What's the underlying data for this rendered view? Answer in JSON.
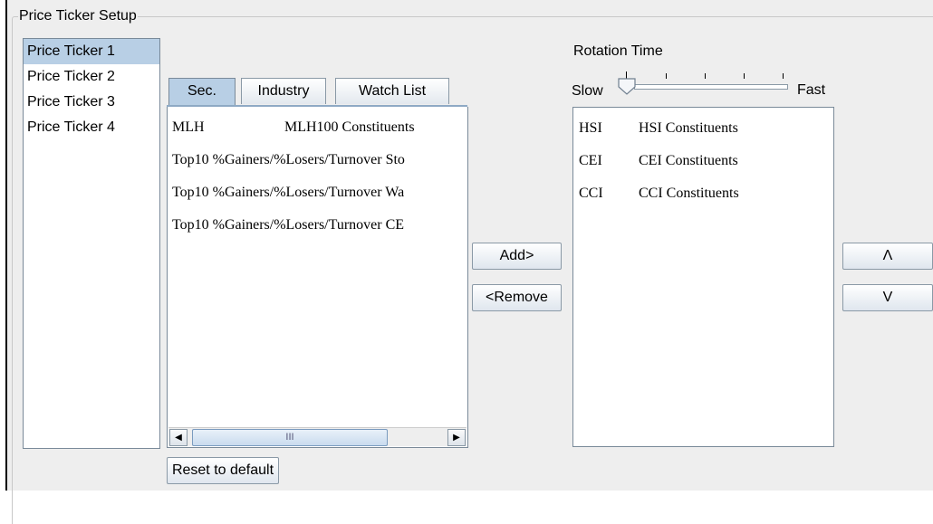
{
  "group_title": "Price Ticker Setup",
  "tickers": [
    {
      "label": "Price Ticker 1",
      "selected": true
    },
    {
      "label": "Price Ticker 2",
      "selected": false
    },
    {
      "label": "Price Ticker 3",
      "selected": false
    },
    {
      "label": "Price Ticker 4",
      "selected": false
    }
  ],
  "tabs": [
    {
      "label": "Sec.",
      "active": true
    },
    {
      "label": "Industry",
      "active": false
    },
    {
      "label": "Watch List",
      "active": false
    }
  ],
  "available_items": [
    {
      "code": "MLH",
      "desc": "MLH100 Constituents"
    },
    {
      "code": "Top10 %Gainers/%Losers/Turnover Sto",
      "desc": ""
    },
    {
      "code": "Top10 %Gainers/%Losers/Turnover Wa",
      "desc": ""
    },
    {
      "code": "Top10 %Gainers/%Losers/Turnover CE",
      "desc": ""
    }
  ],
  "scroll_grip": "III",
  "buttons": {
    "add": "Add>",
    "remove": "<Remove",
    "move_up": "Λ",
    "move_down": "V",
    "reset": "Reset to default"
  },
  "rotation": {
    "label": "Rotation Time",
    "slow": "Slow",
    "fast": "Fast",
    "value_fraction": 0.0
  },
  "selected_items": [
    {
      "code": "HSI",
      "desc": "HSI Constituents"
    },
    {
      "code": "CEI",
      "desc": "CEI Constituents"
    },
    {
      "code": "CCI",
      "desc": "CCI Constituents"
    }
  ],
  "colors": {
    "selection": "#b8cfe5",
    "panel_bg": "#eeeeee"
  }
}
